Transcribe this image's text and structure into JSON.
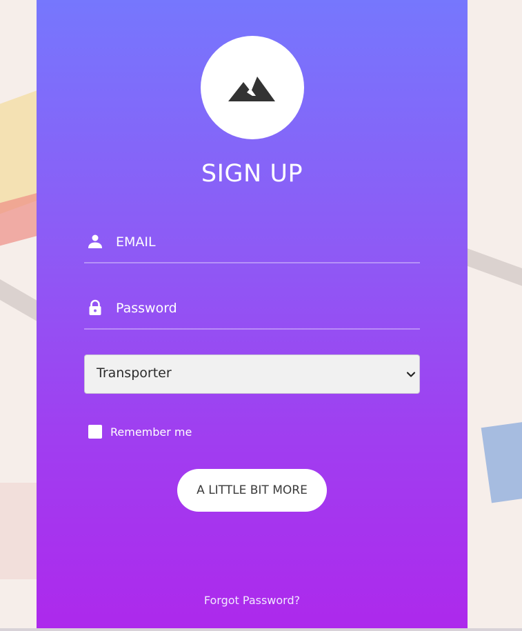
{
  "form": {
    "title": "SIGN UP",
    "email": {
      "placeholder": "EMAIL",
      "value": ""
    },
    "password": {
      "placeholder": "Password",
      "value": ""
    },
    "role_select": {
      "selected": "Transporter"
    },
    "remember": {
      "label": "Remember me",
      "checked": false
    },
    "submit_label": "A LITTLE BIT MORE",
    "forgot_label": "Forgot Password?"
  },
  "icons": {
    "logo": "mountain-icon",
    "email": "user-icon",
    "password": "lock-icon",
    "select": "chevron-down-icon"
  },
  "colors": {
    "gradient_top": "#7677fd",
    "gradient_bottom": "#ad29ec",
    "button_bg": "#ffffff",
    "text_on_panel": "#ffffff"
  }
}
